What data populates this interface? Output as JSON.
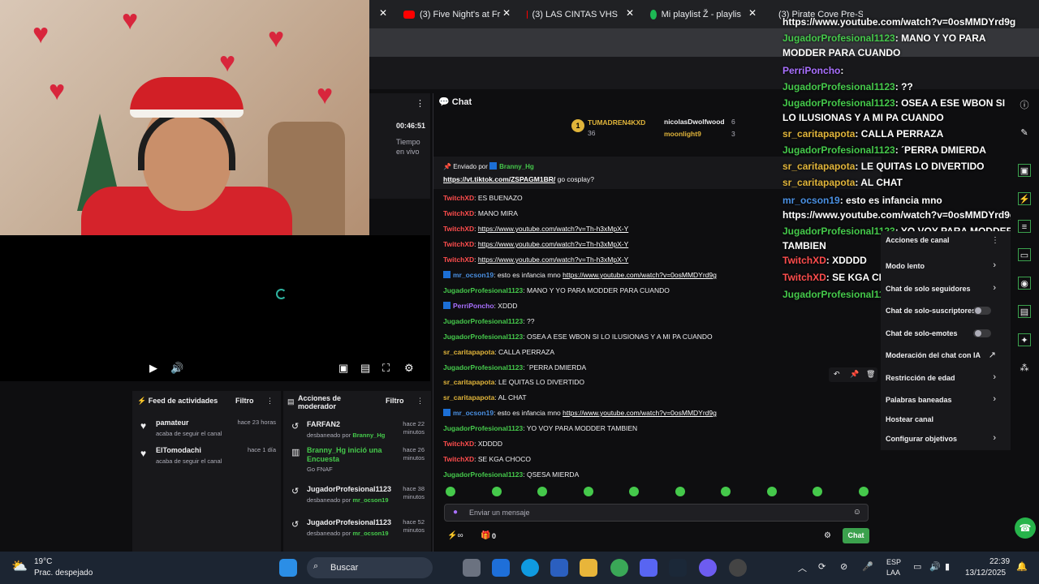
{
  "browser_tabs": [
    {
      "label": "(3) Five Night's at Fr"
    },
    {
      "label": "(3) LAS CINTAS VHS"
    },
    {
      "label": "Mi playlist Ž - playlis"
    },
    {
      "label": "(3) Pirate Cove Pre-S"
    }
  ],
  "player": {
    "time": "00:46:51",
    "live_label_1": "Tiempo",
    "live_label_2": "en vivo"
  },
  "chat": {
    "header": "Chat",
    "leaderboard": {
      "rank": "1",
      "first_name": "TUMADREN4KXD",
      "first_count": "36",
      "second_name": "nicolasDwolfwood",
      "second_count": "6",
      "third_name": "moonlight9",
      "third_count": "3"
    },
    "pinned": {
      "label": "Enviado por",
      "by": "Branny_Hg",
      "link": "https://vt.tiktok.com/ZSPAGM1BR/",
      "text": "go cosplay?"
    },
    "messages": [
      {
        "user": "TwitchXD",
        "text": "ES BUENAZO",
        "cls": "u-red"
      },
      {
        "user": "TwitchXD",
        "text": "MANO MIRA",
        "cls": "u-red"
      },
      {
        "user": "TwitchXD",
        "text": "https://www.youtube.com/watch?v=Th-h3xMpX-Y",
        "cls": "u-red",
        "link": true
      },
      {
        "user": "TwitchXD",
        "text": "https://www.youtube.com/watch?v=Th-h3xMpX-Y",
        "cls": "u-red",
        "link": true
      },
      {
        "user": "TwitchXD",
        "text": "https://www.youtube.com/watch?v=Th-h3xMpX-Y",
        "cls": "u-red",
        "link": true
      },
      {
        "user": "mr_ocson19",
        "text": "esto es infancia mno",
        "link_text": "https://www.youtube.com/watch?v=0osMMDYrd9g",
        "cls": "u-blue",
        "badge": true
      },
      {
        "user": "JugadorProfesional1123",
        "text": "MANO Y YO PARA MODDER PARA CUANDO",
        "cls": "u-green"
      },
      {
        "user": "PerriPoncho",
        "text": "XDDD",
        "cls": "u-purple",
        "badge": true
      },
      {
        "user": "JugadorProfesional1123",
        "text": "??",
        "cls": "u-green"
      },
      {
        "user": "JugadorProfesional1123",
        "text": "OSEA A ESE WBON SI LO ILUSIONAS Y A MI PA CUANDO",
        "cls": "u-green"
      },
      {
        "user": "sr_caritapapota",
        "text": "CALLA PERRAZA",
        "cls": "u-gold"
      },
      {
        "user": "JugadorProfesional1123",
        "text": "´PERRA DMIERDA",
        "cls": "u-green"
      },
      {
        "user": "sr_caritapapota",
        "text": "LE QUITAS LO DIVERTIDO",
        "cls": "u-gold"
      },
      {
        "user": "sr_caritapapota",
        "text": "AL CHAT",
        "cls": "u-gold"
      },
      {
        "user": "mr_ocson19",
        "text": "esto es infancia mno",
        "link_text": "https://www.youtube.com/watch?v=0osMMDYrd9g",
        "cls": "u-blue",
        "badge": true
      },
      {
        "user": "JugadorProfesional1123",
        "text": "YO VOY PARA MODDER TAMBIEN",
        "cls": "u-green"
      },
      {
        "user": "TwitchXD",
        "text": "XDDDD",
        "cls": "u-red"
      },
      {
        "user": "TwitchXD",
        "text": "SE KGA CHOCO",
        "cls": "u-red"
      },
      {
        "user": "JugadorProfesional1123",
        "text": "QSESA MIERDA",
        "cls": "u-green"
      }
    ],
    "input_placeholder": "Enviar un mensaje",
    "points": "0",
    "send_label": "Chat"
  },
  "overlay": [
    {
      "user": "",
      "text": "https://www.youtube.com/watch?v=0osMMDYrd9g",
      "color": "#ffffff"
    },
    {
      "user": "JugadorProfesional1123",
      "text": ": MANO Y YO PARA MODDER PARA CUANDO",
      "color": "#45c94b"
    },
    {
      "user": "PerriPoncho",
      "text": ":",
      "color": "#a970ff"
    },
    {
      "user": "JugadorProfesional1123",
      "text": ": ??",
      "color": "#45c94b"
    },
    {
      "user": "JugadorProfesional1123",
      "text": ": OSEA A ESE WBON SI LO ILUSIONAS Y A MI PA CUANDO",
      "color": "#45c94b"
    },
    {
      "user": "sr_caritapapota",
      "text": ": CALLA PERRAZA",
      "color": "#e0b43a"
    },
    {
      "user": "JugadorProfesional1123",
      "text": ": ´PERRA DMIERDA",
      "color": "#45c94b"
    },
    {
      "user": "sr_caritapapota",
      "text": ": LE QUITAS LO DIVERTIDO",
      "color": "#e0b43a"
    },
    {
      "user": "sr_caritapapota",
      "text": ": AL CHAT",
      "color": "#e0b43a"
    },
    {
      "user": "mr_ocson19",
      "text": ": esto es infancia mno https://www.youtube.com/watch?v=0osMMDYrd9g",
      "color": "#4a90e2"
    },
    {
      "user": "JugadorProfesional1123",
      "text": ": YO VOY PARA MODDER TAMBIEN",
      "color": "#45c94b"
    },
    {
      "user": "TwitchXD",
      "text": ": XDDDD",
      "color": "#ff4d4d"
    },
    {
      "user": "TwitchXD",
      "text": ": SE KGA CHOCO",
      "color": "#ff4d4d"
    },
    {
      "user": "JugadorProfesional1123",
      "text": ": QSESA MIERDA",
      "color": "#45c94b"
    }
  ],
  "sidebar": {
    "title": "Acciones de canal",
    "items": [
      "Modo lento",
      "Chat de solo seguidores",
      "Chat de solo-suscriptores",
      "Chat de solo-emotes",
      "Moderación del chat con IA",
      "Restricción de edad",
      "Palabras baneadas",
      "Hostear canal",
      "Configurar objetivos"
    ]
  },
  "feed": {
    "title": "Feed de actividades",
    "filter": "Filtro",
    "items": [
      {
        "name": "pamateur",
        "sub": "acaba de seguir el canal",
        "time": "hace 23 horas"
      },
      {
        "name": "ElTomodachi",
        "sub": "acaba de seguir el canal",
        "time": "hace 1 día"
      }
    ]
  },
  "mod": {
    "title": "Acciones de moderador",
    "filter": "Filtro",
    "items": [
      {
        "name": "FARFAN2",
        "sub": "desbaneado por",
        "by": "Branny_Hg",
        "time": "hace 22 minutos"
      },
      {
        "name": "Branny_Hg inició una Encuesta",
        "sub": "Go FNAF",
        "by": "",
        "time": "hace 26 minutos"
      },
      {
        "name": "JugadorProfesional1123",
        "sub": "desbaneado por",
        "by": "mr_ocson19",
        "time": "hace 38 minutos"
      },
      {
        "name": "JugadorProfesional1123",
        "sub": "desbaneado por",
        "by": "mr_ocson19",
        "time": "hace 52 minutos"
      }
    ]
  },
  "taskbar": {
    "temp": "19°C",
    "weather": "Prac. despejado",
    "search": "Buscar",
    "lang1": "ESP",
    "lang2": "LAA",
    "time": "22:39",
    "date": "13/12/2025"
  }
}
